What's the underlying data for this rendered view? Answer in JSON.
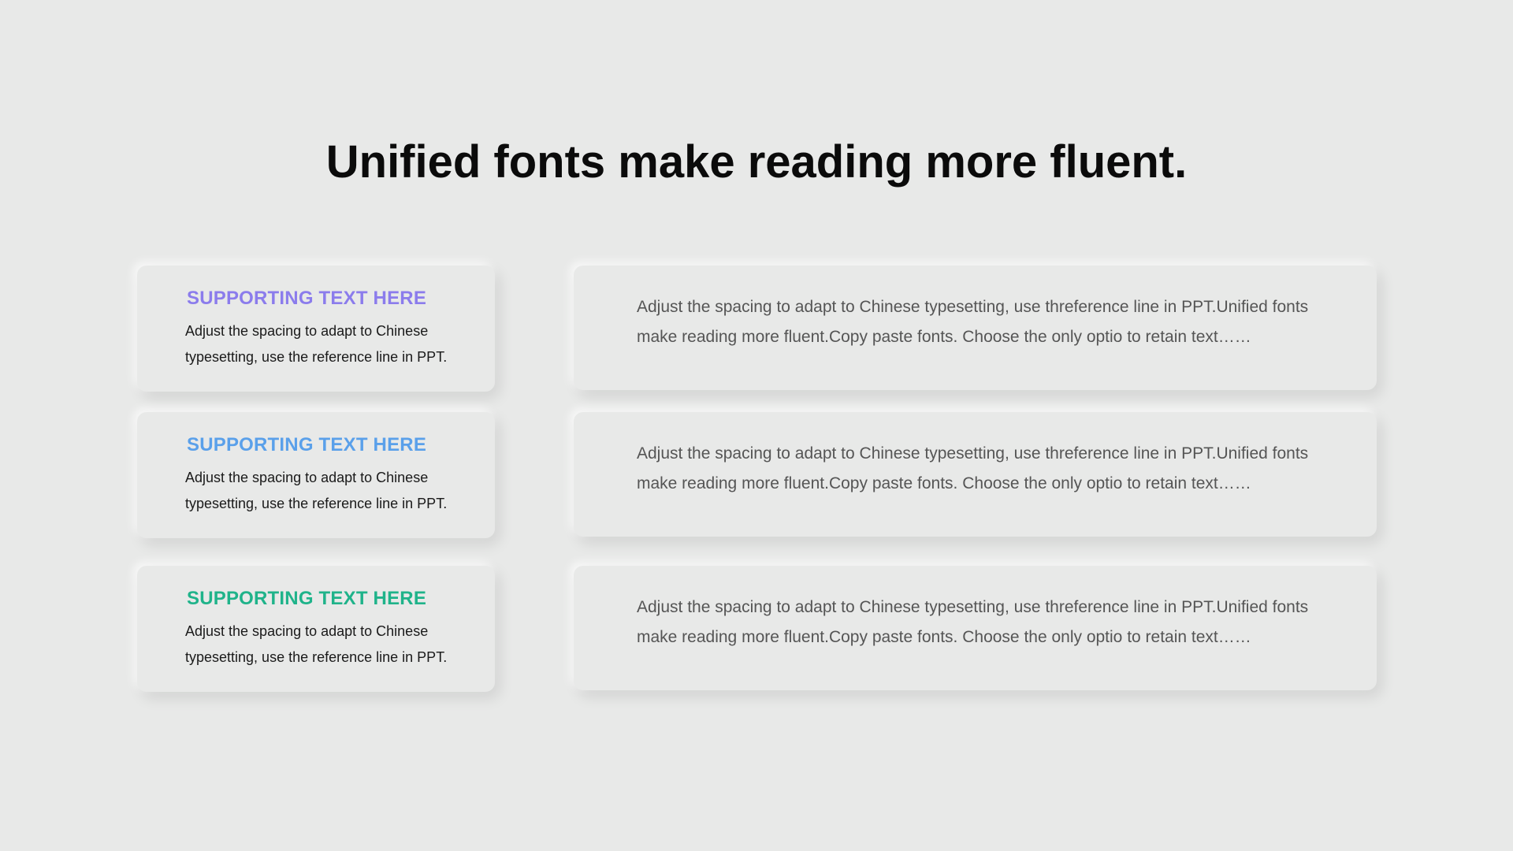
{
  "title": "Unified fonts make reading more fluent.",
  "rows": [
    {
      "heading": "SUPPORTING TEXT HERE",
      "heading_color": "#8b7cec",
      "summary": "Adjust the spacing to adapt to Chinese typesetting, use the reference line in PPT.",
      "description": "Adjust the spacing to adapt to Chinese typesetting, use threference line in PPT.Unified fonts make reading more fluent.Copy paste fonts. Choose the only optio to retain text……"
    },
    {
      "heading": "SUPPORTING TEXT HERE",
      "heading_color": "#5aa0ea",
      "summary": "Adjust the spacing to adapt to Chinese typesetting, use the reference line in PPT.",
      "description": "Adjust the spacing to adapt to Chinese typesetting, use threference line in PPT.Unified fonts make reading more fluent.Copy paste fonts. Choose the only optio to retain text……"
    },
    {
      "heading": "SUPPORTING TEXT HERE",
      "heading_color": "#1fb38a",
      "summary": "Adjust the spacing to adapt to Chinese typesetting, use the reference line in PPT.",
      "description": "Adjust the spacing to adapt to Chinese typesetting, use threference line in PPT.Unified fonts make reading more fluent.Copy paste fonts. Choose the only optio to retain text……"
    }
  ]
}
